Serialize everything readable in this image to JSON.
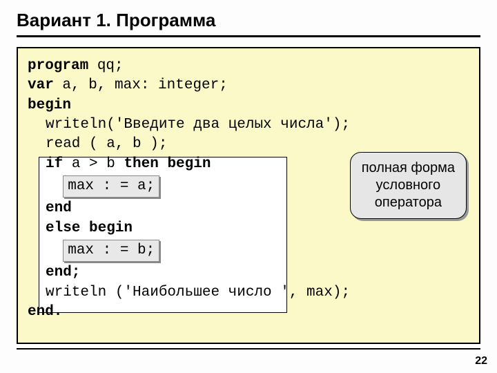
{
  "title": "Вариант 1. Программа",
  "code": {
    "l1a": "program",
    "l1b": " qq;",
    "l2a": "var",
    "l2b": " a, b, max: integer;",
    "l3": "begin",
    "l4": "writeln('Введите два целых числа');",
    "l5": "read ( a, b );",
    "l6a": "if",
    "l6b": " a > b ",
    "l6c": "then begin",
    "chip1": "max : = a;",
    "l8": "end",
    "l9a": "else ",
    "l9b": "begin",
    "chip2": "max : = b;",
    "l11": "end;",
    "l12": "writeln ('Наибольшее число ', max);",
    "l13": "end."
  },
  "callout": {
    "line1": "полная форма",
    "line2": "условного",
    "line3": "оператора"
  },
  "pagenum": "22"
}
